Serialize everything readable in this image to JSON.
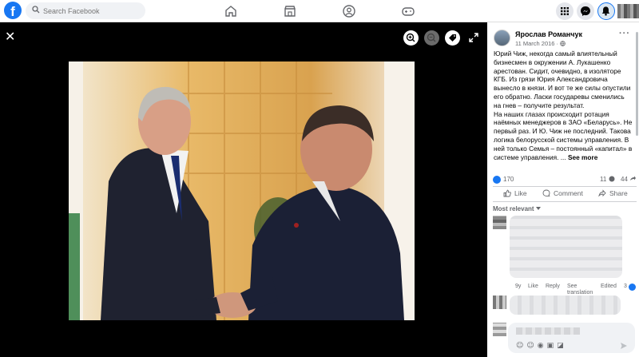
{
  "topbar": {
    "logo_letter": "f",
    "search_placeholder": "Search Facebook"
  },
  "post": {
    "author": "Ярослав Романчук",
    "date": "11 March 2016 · ",
    "text_lines": [
      "Юрий Чиж, некогда самый влиятельный",
      "бизнесмен в окружении А. Лукашенко",
      "арестован. Сидит, очевидно, в изоляторе",
      "КГБ. Из грязи Юрия Александровича",
      "вынесло в князи. И вот те же силы опустили",
      "его обратно. Ласки государевы сменились",
      "на гнев – получите результат.",
      "На наших глазах происходит ротация",
      "наёмных менеджеров в ЗАО «Беларусь». Не",
      "первый раз. И Ю. Чиж не последний. Такова",
      "логика белорусской системы управления. В",
      "ней только Семья – постоянный «капитал» в",
      "системе управления. ... "
    ],
    "see_more": "See more",
    "reaction_count": "170",
    "comment_count": "11",
    "share_count": "44",
    "like_label": "Like",
    "comment_label": "Comment",
    "share_label": "Share",
    "sort_label": "Most relevant"
  },
  "comment": {
    "age": "9y",
    "like": "Like",
    "reply": "Reply",
    "see_translation_1": "See",
    "see_translation_2": "translation",
    "edited": "Edited",
    "reaction_count": "3"
  },
  "icons": [
    "search-icon",
    "home-icon",
    "marketplace-icon",
    "groups-icon",
    "gaming-icon",
    "menu-grid-icon",
    "messenger-icon",
    "bell-icon",
    "close-icon",
    "zoom-in-icon",
    "zoom-out-icon",
    "tag-icon",
    "fullscreen-icon",
    "globe-icon",
    "like-icon",
    "comment-icon",
    "share-icon",
    "chevron-down-icon"
  ],
  "colors": {
    "brand": "#1877f2",
    "panel_bg": "#ffffff",
    "viewer_bg": "#000000"
  }
}
